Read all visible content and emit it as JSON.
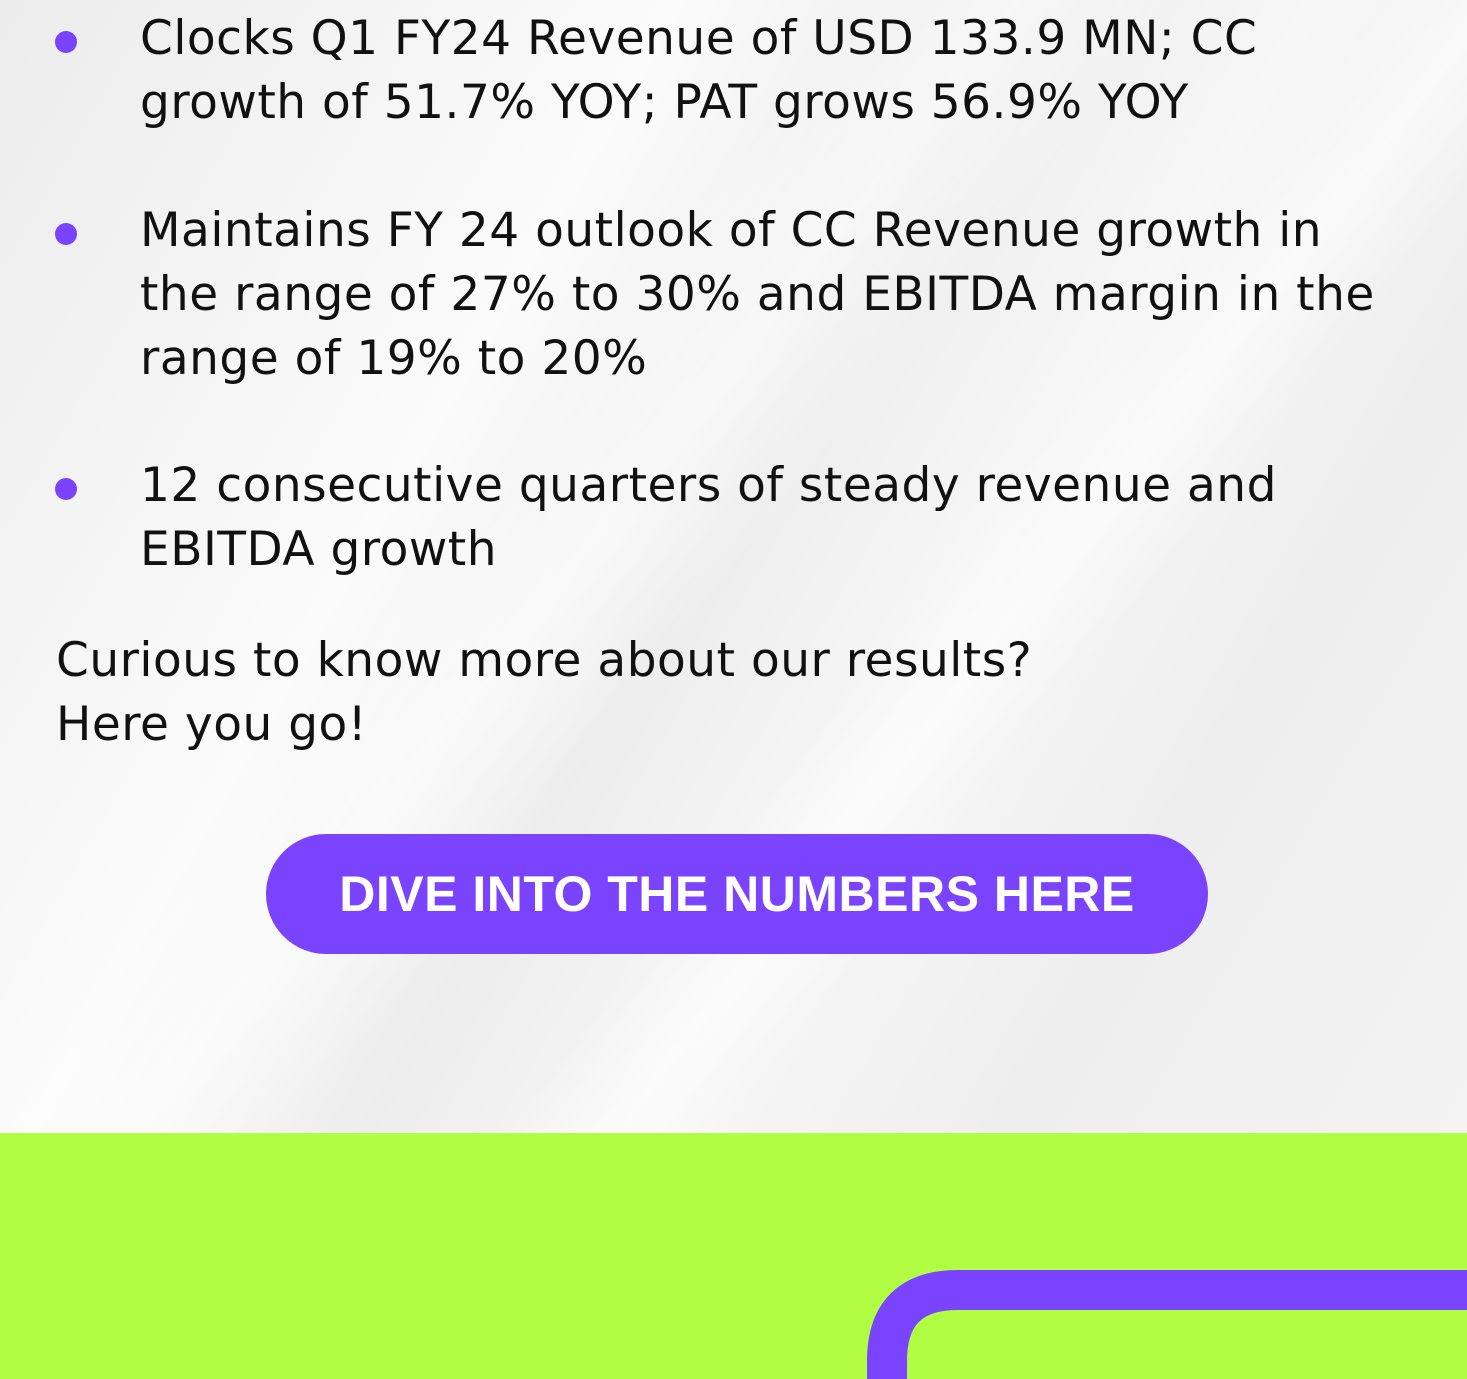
{
  "highlights": {
    "items": [
      {
        "text": "Clocks Q1 FY24 Revenue of USD 133.9 MN; CC growth of 51.7% YOY; PAT grows 56.9% YOY"
      },
      {
        "text": "Maintains FY 24 outlook of CC Revenue growth in the range of 27% to 30% and EBITDA margin in the range of 19% to 20%"
      },
      {
        "text": "12 consecutive quarters of steady revenue and EBITDA growth"
      }
    ]
  },
  "cta": {
    "line1": "Curious to know more about our results?",
    "line2": "Here you go!",
    "button_label": "DIVE INTO THE NUMBERS HERE"
  },
  "colors": {
    "accent": "#7a44ff",
    "footer_background": "#b1fd44",
    "text": "#111111"
  }
}
